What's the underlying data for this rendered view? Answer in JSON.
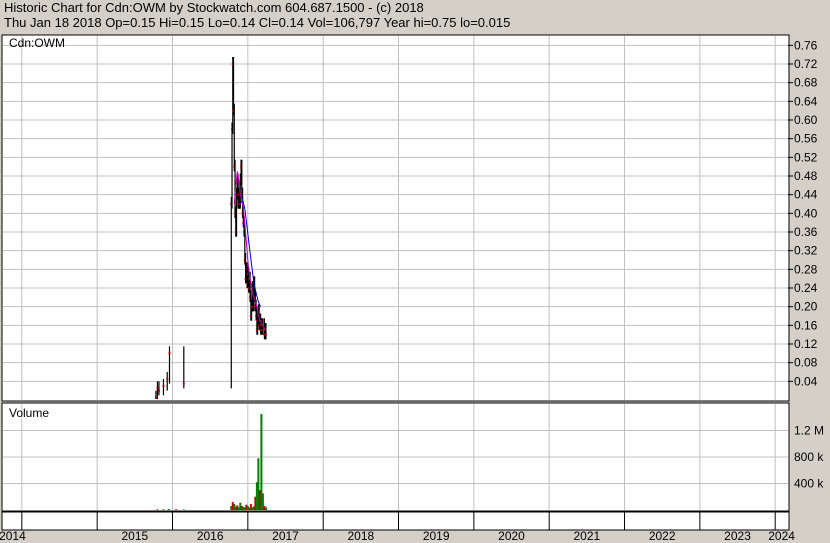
{
  "header": {
    "line1": "Historic Chart for Cdn:OWM by Stockwatch.com 604.687.1500 - (c) 2018",
    "line2": "Thu Jan 18 2018  Op=0.15  Hi=0.15  Lo=0.14  Cl=0.14  Vol=106,797  Year hi=0.75  lo=0.015"
  },
  "chart_data": {
    "type": "line",
    "title": "Historic Chart for Cdn:OWM",
    "price_panel_label": "Cdn:OWM",
    "volume_panel_label": "Volume",
    "price_axis": {
      "min": 0,
      "max": 0.78,
      "ticks": [
        0.04,
        0.08,
        0.12,
        0.16,
        0.2,
        0.24,
        0.28,
        0.32,
        0.36,
        0.4,
        0.44,
        0.48,
        0.52,
        0.56,
        0.6,
        0.64,
        0.68,
        0.72,
        0.76
      ],
      "tick_labels": [
        "0.04",
        "0.08",
        "0.12",
        "0.16",
        "0.20",
        "0.24",
        "0.28",
        "0.32",
        "0.36",
        "0.40",
        "0.44",
        "0.48",
        "0.52",
        "0.56",
        "0.60",
        "0.64",
        "0.68",
        "0.72",
        "0.76"
      ]
    },
    "volume_axis": {
      "min": 0,
      "max": 1600000,
      "ticks": [
        400000,
        800000,
        1200000
      ],
      "tick_labels": [
        "400 k",
        "800 k",
        "1.2 M"
      ]
    },
    "x_axis": {
      "min": 2013.75,
      "max": 2024.17,
      "year_starts": [
        2014,
        2015,
        2016,
        2017,
        2018,
        2019,
        2020,
        2021,
        2022,
        2023,
        2024
      ],
      "labels": [
        "2014",
        "2015",
        "2016",
        "2017",
        "2018",
        "2019",
        "2020",
        "2021",
        "2022",
        "2023",
        "2024"
      ]
    },
    "grid": true,
    "price_series": [
      [
        2015.78,
        0.005
      ],
      [
        2015.8,
        0.025
      ],
      [
        2015.82,
        0.02
      ],
      [
        2015.88,
        0.03
      ],
      [
        2015.93,
        0.045
      ],
      [
        2015.96,
        0.1
      ],
      [
        2016.15,
        0.035
      ],
      [
        2016.78,
        0.42
      ],
      [
        2016.79,
        0.58
      ],
      [
        2016.8,
        0.72
      ],
      [
        2016.81,
        0.62
      ],
      [
        2016.82,
        0.5
      ],
      [
        2016.83,
        0.4
      ],
      [
        2016.84,
        0.36
      ],
      [
        2016.85,
        0.44
      ],
      [
        2016.86,
        0.47
      ],
      [
        2016.87,
        0.42
      ],
      [
        2016.88,
        0.44
      ],
      [
        2016.89,
        0.42
      ],
      [
        2016.9,
        0.47
      ],
      [
        2016.91,
        0.5
      ],
      [
        2016.92,
        0.44
      ],
      [
        2016.93,
        0.4
      ],
      [
        2016.94,
        0.38
      ],
      [
        2016.95,
        0.36
      ],
      [
        2016.96,
        0.3
      ],
      [
        2016.97,
        0.26
      ],
      [
        2016.98,
        0.28
      ],
      [
        2016.99,
        0.25
      ],
      [
        2017.0,
        0.27
      ],
      [
        2017.01,
        0.24
      ],
      [
        2017.02,
        0.26
      ],
      [
        2017.03,
        0.22
      ],
      [
        2017.04,
        0.18
      ],
      [
        2017.05,
        0.2
      ],
      [
        2017.06,
        0.24
      ],
      [
        2017.07,
        0.2
      ],
      [
        2017.08,
        0.25
      ],
      [
        2017.09,
        0.22
      ],
      [
        2017.1,
        0.2
      ],
      [
        2017.11,
        0.18
      ],
      [
        2017.12,
        0.15
      ],
      [
        2017.13,
        0.17
      ],
      [
        2017.14,
        0.19
      ],
      [
        2017.15,
        0.16
      ],
      [
        2017.16,
        0.17
      ],
      [
        2017.17,
        0.15
      ],
      [
        2017.18,
        0.16
      ],
      [
        2017.19,
        0.15
      ],
      [
        2017.2,
        0.16
      ],
      [
        2017.22,
        0.14
      ],
      [
        2017.23,
        0.15
      ],
      [
        2017.24,
        0.14
      ]
    ],
    "ma_short": [
      [
        2016.82,
        0.42
      ],
      [
        2016.84,
        0.46
      ],
      [
        2016.86,
        0.49
      ],
      [
        2016.88,
        0.47
      ],
      [
        2016.9,
        0.44
      ],
      [
        2016.92,
        0.43
      ],
      [
        2016.94,
        0.41
      ],
      [
        2016.96,
        0.38
      ],
      [
        2016.98,
        0.34
      ],
      [
        2017.0,
        0.3
      ],
      [
        2017.02,
        0.27
      ],
      [
        2017.04,
        0.25
      ],
      [
        2017.06,
        0.23
      ],
      [
        2017.08,
        0.22
      ],
      [
        2017.1,
        0.21
      ],
      [
        2017.12,
        0.2
      ],
      [
        2017.14,
        0.18
      ],
      [
        2017.16,
        0.17
      ],
      [
        2017.18,
        0.165
      ],
      [
        2017.2,
        0.16
      ],
      [
        2017.23,
        0.15
      ]
    ],
    "ma_long": [
      [
        2016.9,
        0.42
      ],
      [
        2016.93,
        0.43
      ],
      [
        2016.96,
        0.41
      ],
      [
        2016.99,
        0.37
      ],
      [
        2017.02,
        0.33
      ],
      [
        2017.05,
        0.29
      ],
      [
        2017.08,
        0.25
      ],
      [
        2017.11,
        0.23
      ],
      [
        2017.14,
        0.21
      ],
      [
        2017.17,
        0.2
      ]
    ],
    "volume_series": [
      [
        2015.8,
        10000
      ],
      [
        2015.88,
        12000
      ],
      [
        2015.95,
        15000
      ],
      [
        2016.05,
        12000
      ],
      [
        2016.15,
        8000
      ],
      [
        2016.78,
        60000
      ],
      [
        2016.8,
        120000
      ],
      [
        2016.82,
        90000
      ],
      [
        2016.84,
        50000
      ],
      [
        2016.86,
        70000
      ],
      [
        2016.88,
        40000
      ],
      [
        2016.9,
        110000
      ],
      [
        2016.92,
        60000
      ],
      [
        2016.94,
        45000
      ],
      [
        2016.96,
        40000
      ],
      [
        2016.98,
        80000
      ],
      [
        2017.0,
        60000
      ],
      [
        2017.02,
        35000
      ],
      [
        2017.04,
        90000
      ],
      [
        2017.06,
        40000
      ],
      [
        2017.08,
        55000
      ],
      [
        2017.1,
        200000
      ],
      [
        2017.12,
        420000
      ],
      [
        2017.14,
        780000
      ],
      [
        2017.16,
        300000
      ],
      [
        2017.18,
        1450000
      ],
      [
        2017.2,
        250000
      ],
      [
        2017.22,
        60000
      ],
      [
        2017.24,
        40000
      ]
    ]
  },
  "colors": {
    "price": "#000000",
    "ma_short": "#c000c0",
    "ma_long": "#0000c0",
    "volume_up": "#008000",
    "volume_down": "#c00000",
    "grid": "#c0c0c0"
  }
}
